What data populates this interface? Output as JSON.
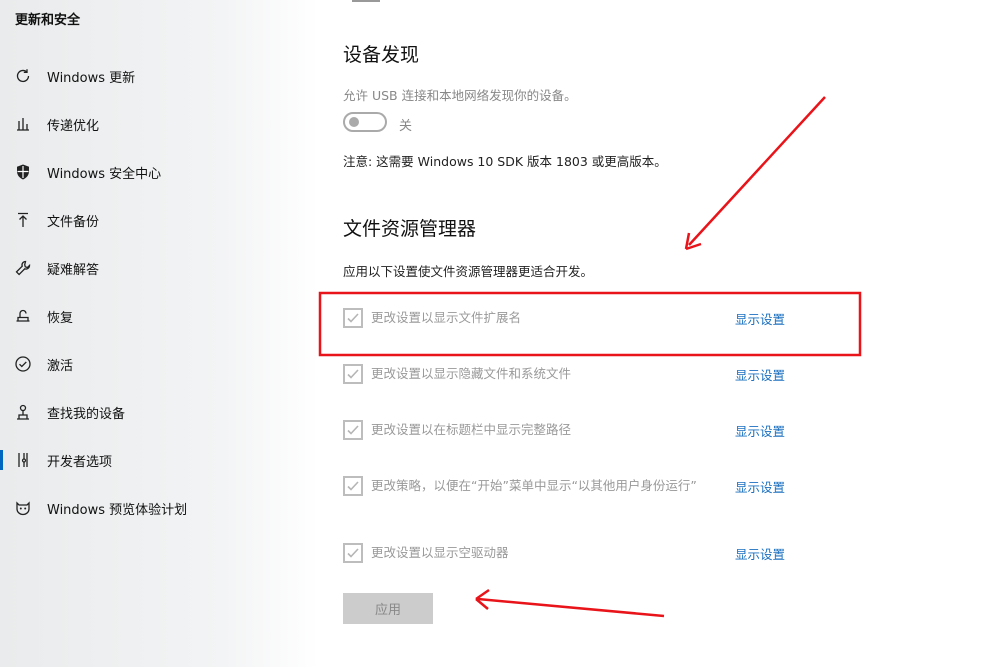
{
  "sidebar": {
    "header": "更新和安全",
    "items": [
      {
        "label": "Windows 更新",
        "icon": "refresh-icon"
      },
      {
        "label": "传递优化",
        "icon": "delivery-icon"
      },
      {
        "label": "Windows 安全中心",
        "icon": "shield-icon"
      },
      {
        "label": "文件备份",
        "icon": "backup-icon"
      },
      {
        "label": "疑难解答",
        "icon": "wrench-icon"
      },
      {
        "label": "恢复",
        "icon": "recovery-icon"
      },
      {
        "label": "激活",
        "icon": "check-circle-icon"
      },
      {
        "label": "查找我的设备",
        "icon": "find-device-icon"
      },
      {
        "label": "开发者选项",
        "icon": "developer-icon",
        "active": true
      },
      {
        "label": "Windows 预览体验计划",
        "icon": "insider-icon"
      }
    ]
  },
  "device_discovery": {
    "title": "设备发现",
    "description": "允许 USB 连接和本地网络发现你的设备。",
    "toggle_state": "关",
    "note": "注意: 这需要 Windows 10 SDK 版本 1803 或更高版本。"
  },
  "file_explorer": {
    "title": "文件资源管理器",
    "description": "应用以下设置使文件资源管理器更适合开发。",
    "options": [
      {
        "text": "更改设置以显示文件扩展名",
        "link": "显示设置",
        "checked": true
      },
      {
        "text": "更改设置以显示隐藏文件和系统文件",
        "link": "显示设置",
        "checked": true
      },
      {
        "text": "更改设置以在标题栏中显示完整路径",
        "link": "显示设置",
        "checked": true
      },
      {
        "text": "更改策略，以便在“开始”菜单中显示“以其他用户身份运行”",
        "link": "显示设置",
        "checked": true
      },
      {
        "text": "更改设置以显示空驱动器",
        "link": "显示设置",
        "checked": true
      }
    ],
    "apply_label": "应用"
  },
  "colors": {
    "accent": "#0067c0",
    "link": "#1a6fbf",
    "annotation": "#e8141a"
  }
}
